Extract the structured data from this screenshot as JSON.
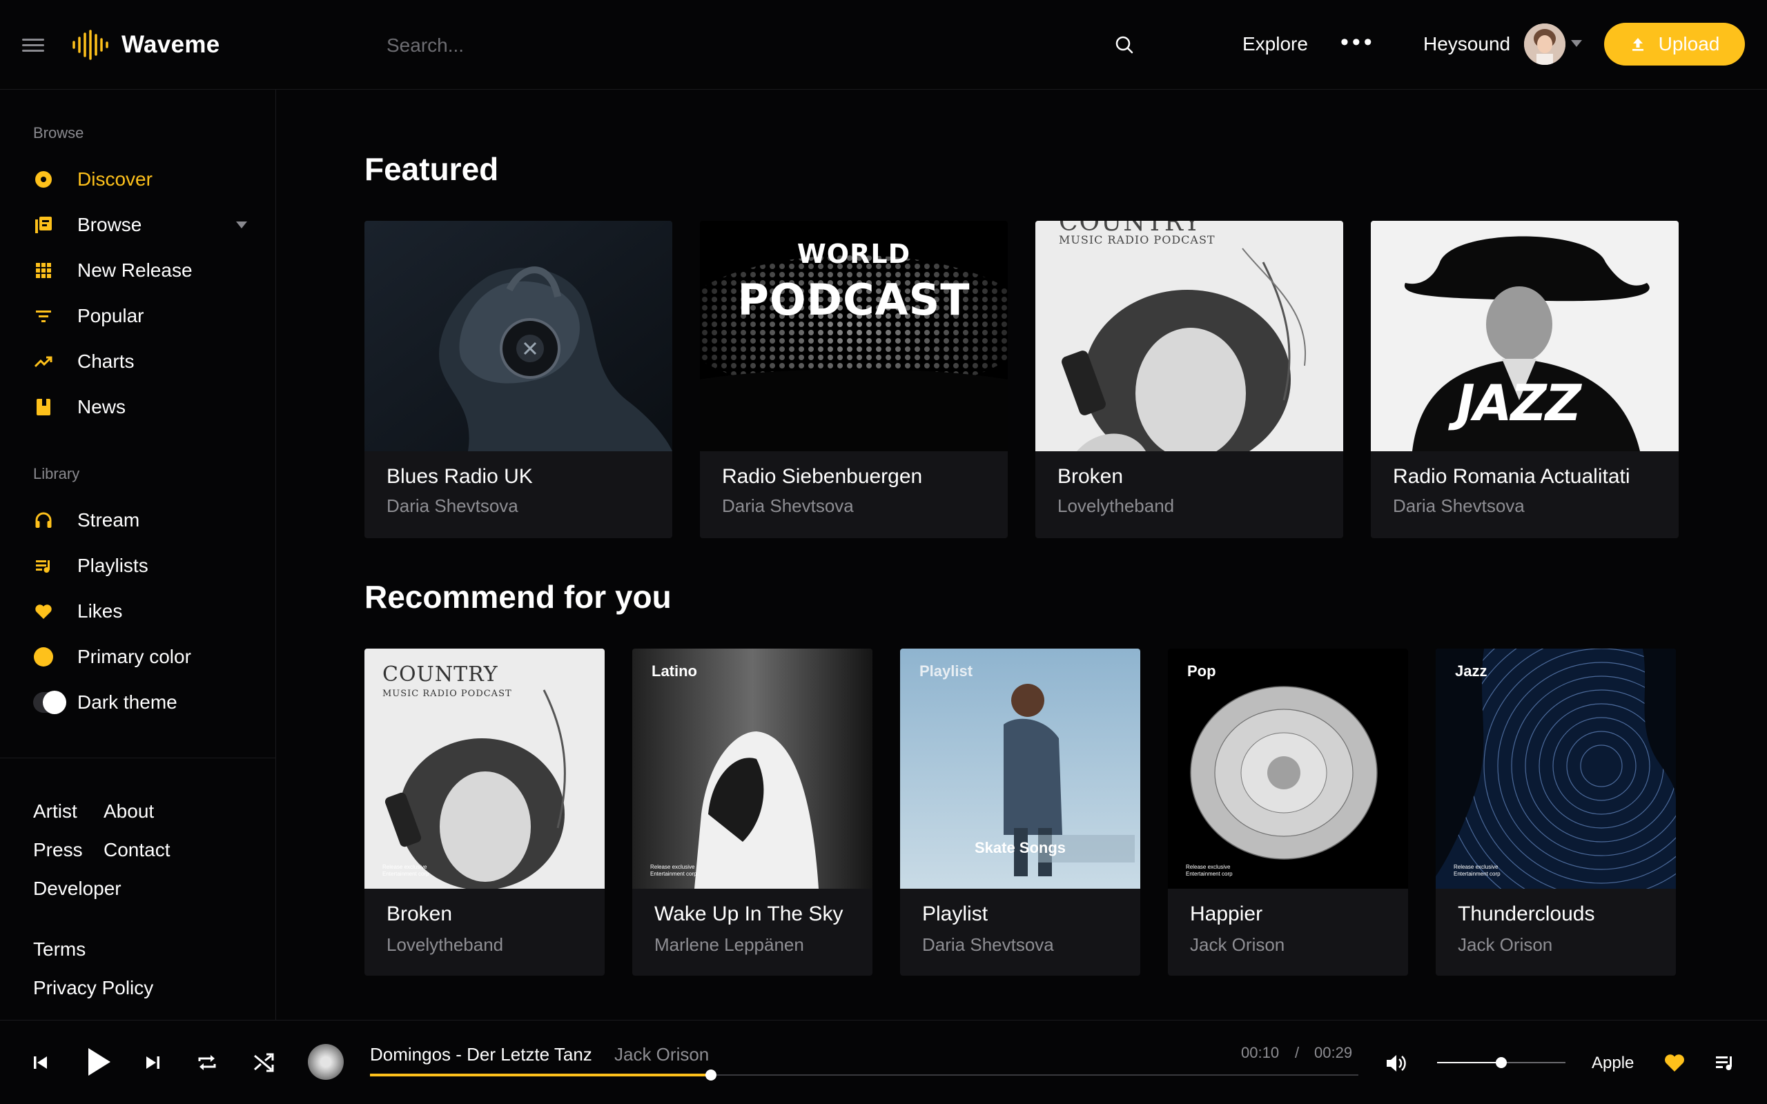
{
  "app": {
    "name": "Waveme"
  },
  "header": {
    "search_placeholder": "Search...",
    "explore": "Explore",
    "more": "•••",
    "user_name": "Heysound",
    "upload": "Upload"
  },
  "sidebar": {
    "browse_label": "Browse",
    "browse_items": [
      {
        "label": "Discover",
        "icon": "disc-icon",
        "active": true
      },
      {
        "label": "Browse",
        "icon": "library-icon"
      },
      {
        "label": "New Release",
        "icon": "grid-icon"
      },
      {
        "label": "Popular",
        "icon": "filter-icon"
      },
      {
        "label": "Charts",
        "icon": "trending-icon"
      },
      {
        "label": "News",
        "icon": "book-icon"
      }
    ],
    "library_label": "Library",
    "library_items": [
      {
        "label": "Stream",
        "icon": "headphones-icon"
      },
      {
        "label": "Playlists",
        "icon": "playlist-icon"
      },
      {
        "label": "Likes",
        "icon": "heart-icon"
      },
      {
        "label": "Primary color",
        "icon": "color-dot-icon"
      },
      {
        "label": "Dark theme",
        "icon": "toggle-icon"
      }
    ],
    "footer_links": [
      "Artist",
      "About",
      "Press",
      "Contact",
      "Developer",
      "Terms",
      "Privacy Policy"
    ]
  },
  "featured": {
    "title": "Featured",
    "items": [
      {
        "title": "Blues Radio UK",
        "subtitle": "Daria Shevtsova"
      },
      {
        "title": "Radio Siebenbuergen",
        "subtitle": "Daria Shevtsova",
        "art_text": [
          "WORLD",
          "PODCAST"
        ]
      },
      {
        "title": "Broken",
        "subtitle": "Lovelytheband",
        "art_text": [
          "COUNTRY",
          "MUSIC RADIO PODCAST"
        ]
      },
      {
        "title": "Radio Romania Actualitati",
        "subtitle": "Daria Shevtsova",
        "art_text": [
          "JAZZ"
        ]
      }
    ]
  },
  "recommend": {
    "title": "Recommend for you",
    "items": [
      {
        "title": "Broken",
        "subtitle": "Lovelytheband",
        "art_text": [
          "COUNTRY",
          "MUSIC RADIO PODCAST",
          "Release exclusive",
          "Entertainment corp"
        ]
      },
      {
        "title": "Wake Up In The Sky",
        "subtitle": "Marlene Leppänen",
        "genre": "Latino",
        "art_text": [
          "Release exclusive",
          "Entertainment corp"
        ]
      },
      {
        "title": "Playlist",
        "subtitle": "Daria Shevtsova",
        "genre": "Playlist",
        "art_text": [
          "Skate Songs"
        ]
      },
      {
        "title": "Happier",
        "subtitle": "Jack Orison",
        "genre": "Pop",
        "art_text": [
          "Release exclusive",
          "Entertainment corp"
        ]
      },
      {
        "title": "Thunderclouds",
        "subtitle": "Jack Orison",
        "genre": "Jazz",
        "art_text": [
          "Release exclusive",
          "Entertainment corp"
        ]
      }
    ]
  },
  "player": {
    "track_title": "Domingos - Der Letzte Tanz",
    "track_artist": "Jack Orison",
    "elapsed": "00:10",
    "separator": "/",
    "duration": "00:29",
    "progress": 0.345,
    "volume": 0.5,
    "device": "Apple",
    "liked": true
  },
  "colors": {
    "accent": "#fec11b",
    "background": "#050506",
    "card": "#141417",
    "muted_text": "#8e8e93"
  }
}
